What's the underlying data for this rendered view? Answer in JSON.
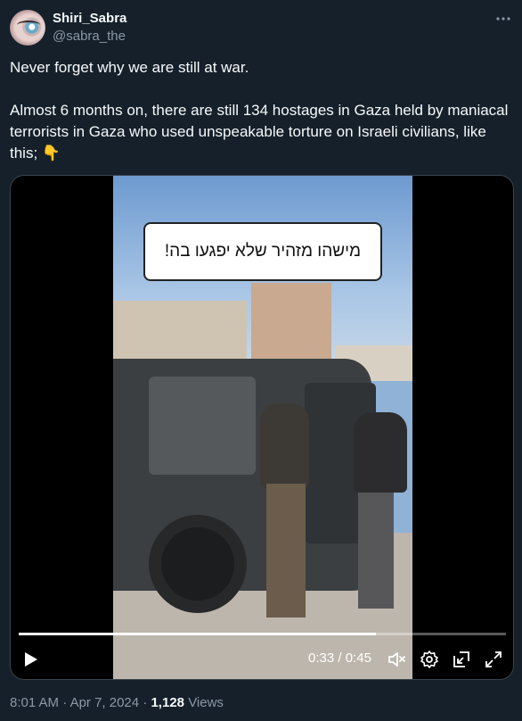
{
  "author": {
    "display_name": "Shiri_Sabra",
    "handle": "@sabra_the"
  },
  "tweet": {
    "paragraph_1": "Never forget why we are still at war.",
    "paragraph_2": "Almost 6 months on, there are still 134 hostages in Gaza held by maniacal terrorists in Gaza who used unspeakable torture on Israeli civilians, like this; 👇"
  },
  "video": {
    "caption": "מישהו מזהיר שלא יפגעו בה!",
    "current_time": "0:33",
    "duration": "0:45",
    "time_separator": " / ",
    "progress_fraction": 0.733
  },
  "meta": {
    "time": "8:01 AM",
    "date": "Apr 7, 2024",
    "separator": " · ",
    "views_count": "1,128",
    "views_label": "Views"
  },
  "icons": {
    "more": "more-horizontal-icon",
    "play": "play-icon",
    "mute": "volume-muted-icon",
    "settings": "settings-gear-icon",
    "pip": "picture-in-picture-icon",
    "fullscreen": "fullscreen-icon"
  },
  "colors": {
    "background": "#15202b",
    "text_primary": "#f7f9f9",
    "text_secondary": "#8b98a5"
  }
}
